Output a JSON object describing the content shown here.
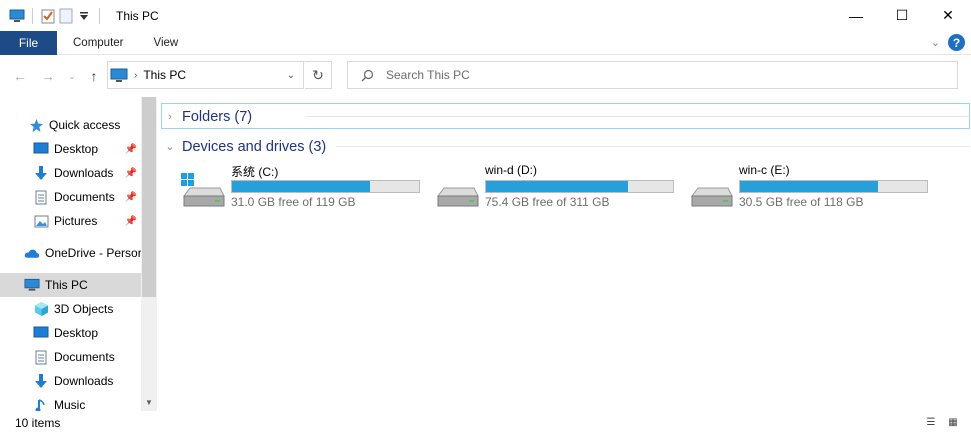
{
  "window": {
    "title": "This PC",
    "controls": {
      "minimize": "—",
      "maximize": "☐",
      "close": "✕"
    }
  },
  "ribbon": {
    "tabs": [
      {
        "label": "File",
        "active": true
      },
      {
        "label": "Computer"
      },
      {
        "label": "View"
      }
    ],
    "help": "?"
  },
  "address": {
    "path": "This PC",
    "search_placeholder": "Search This PC"
  },
  "sidebar": {
    "items": [
      {
        "label": "Quick access",
        "icon": "star-icon",
        "pinned": false
      },
      {
        "label": "Desktop",
        "icon": "desktop-icon",
        "pinned": true
      },
      {
        "label": "Downloads",
        "icon": "downloads-icon",
        "pinned": true
      },
      {
        "label": "Documents",
        "icon": "documents-icon",
        "pinned": true
      },
      {
        "label": "Pictures",
        "icon": "pictures-icon",
        "pinned": true
      },
      {
        "label": "OneDrive - Persor",
        "icon": "onedrive-icon",
        "pinned": false
      },
      {
        "label": "This PC",
        "icon": "this-pc-icon",
        "selected": true
      },
      {
        "label": "3D Objects",
        "icon": "3d-objects-icon"
      },
      {
        "label": "Desktop",
        "icon": "desktop-icon"
      },
      {
        "label": "Documents",
        "icon": "documents-icon"
      },
      {
        "label": "Downloads",
        "icon": "downloads-icon"
      },
      {
        "label": "Music",
        "icon": "music-icon"
      }
    ]
  },
  "content": {
    "folders_group": "Folders (7)",
    "drives_group": "Devices and drives (3)",
    "drives": [
      {
        "name": "系统 (C:)",
        "free": "31.0 GB free of 119 GB",
        "used_fraction": 0.74,
        "system": true
      },
      {
        "name": "win-d (D:)",
        "free": "75.4 GB free of 311 GB",
        "used_fraction": 0.76,
        "system": false
      },
      {
        "name": "win-c (E:)",
        "free": "30.5 GB free of 118 GB",
        "used_fraction": 0.74,
        "system": false
      }
    ]
  },
  "status": {
    "count": "10 items"
  },
  "colors": {
    "file_tab": "#1e4a86",
    "accent_text": "#1e3287",
    "drive_bar": "#26a0da",
    "selected_item": "#d9d9d9"
  }
}
